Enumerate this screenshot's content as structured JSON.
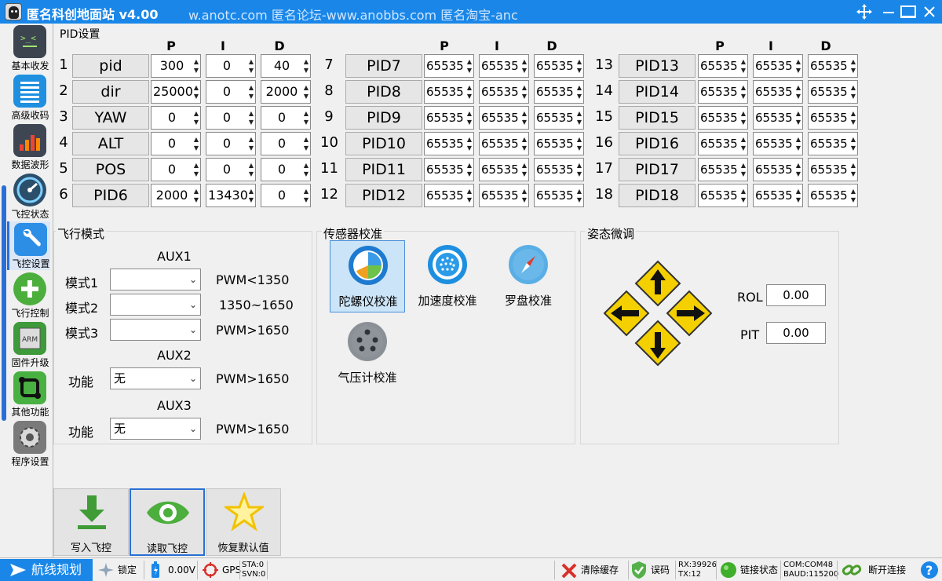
{
  "titlebar": {
    "title": "匿名科创地面站 v4.00",
    "marquee": "w.anotc.com  匿名论坛-www.anobbs.com  匿名淘宝-anc"
  },
  "nav": [
    {
      "label": "基本收发",
      "icon": "terminal-icon"
    },
    {
      "label": "高级收码",
      "icon": "list-icon"
    },
    {
      "label": "数据波形",
      "icon": "bar-chart-icon"
    },
    {
      "label": "飞控状态",
      "icon": "gauge-icon"
    },
    {
      "label": "飞控设置",
      "icon": "wrench-icon"
    },
    {
      "label": "飞行控制",
      "icon": "plus-icon"
    },
    {
      "label": "固件升级",
      "icon": "arm-chip-icon"
    },
    {
      "label": "其他功能",
      "icon": "square-link-icon"
    },
    {
      "label": "程序设置",
      "icon": "gear-icon"
    }
  ],
  "pid": {
    "title": "PID设置",
    "headers": [
      "P",
      "I",
      "D"
    ],
    "rows": [
      {
        "num": "1",
        "name": "pid",
        "p": "300",
        "i": "0",
        "d": "40"
      },
      {
        "num": "2",
        "name": "dir",
        "p": "25000",
        "i": "0",
        "d": "2000"
      },
      {
        "num": "3",
        "name": "YAW",
        "p": "0",
        "i": "0",
        "d": "0"
      },
      {
        "num": "4",
        "name": "ALT",
        "p": "0",
        "i": "0",
        "d": "0"
      },
      {
        "num": "5",
        "name": "POS",
        "p": "0",
        "i": "0",
        "d": "0"
      },
      {
        "num": "6",
        "name": "PID6",
        "p": "2000",
        "i": "13430",
        "d": "0"
      },
      {
        "num": "7",
        "name": "PID7",
        "p": "65535",
        "i": "65535",
        "d": "65535"
      },
      {
        "num": "8",
        "name": "PID8",
        "p": "65535",
        "i": "65535",
        "d": "65535"
      },
      {
        "num": "9",
        "name": "PID9",
        "p": "65535",
        "i": "65535",
        "d": "65535"
      },
      {
        "num": "10",
        "name": "PID10",
        "p": "65535",
        "i": "65535",
        "d": "65535"
      },
      {
        "num": "11",
        "name": "PID11",
        "p": "65535",
        "i": "65535",
        "d": "65535"
      },
      {
        "num": "12",
        "name": "PID12",
        "p": "65535",
        "i": "65535",
        "d": "65535"
      },
      {
        "num": "13",
        "name": "PID13",
        "p": "65535",
        "i": "65535",
        "d": "65535"
      },
      {
        "num": "14",
        "name": "PID14",
        "p": "65535",
        "i": "65535",
        "d": "65535"
      },
      {
        "num": "15",
        "name": "PID15",
        "p": "65535",
        "i": "65535",
        "d": "65535"
      },
      {
        "num": "16",
        "name": "PID16",
        "p": "65535",
        "i": "65535",
        "d": "65535"
      },
      {
        "num": "17",
        "name": "PID17",
        "p": "65535",
        "i": "65535",
        "d": "65535"
      },
      {
        "num": "18",
        "name": "PID18",
        "p": "65535",
        "i": "65535",
        "d": "65535"
      }
    ]
  },
  "flight_mode": {
    "title": "飞行模式",
    "aux1": "AUX1",
    "modes": [
      {
        "label": "模式1",
        "value": "",
        "range": "PWM<1350"
      },
      {
        "label": "模式2",
        "value": "",
        "range": "1350~1650"
      },
      {
        "label": "模式3",
        "value": "",
        "range": "PWM>1650"
      }
    ],
    "aux2": "AUX2",
    "aux2_func": {
      "label": "功能",
      "value": "无",
      "range": "PWM>1650"
    },
    "aux3": "AUX3",
    "aux3_func": {
      "label": "功能",
      "value": "无",
      "range": "PWM>1650"
    }
  },
  "sensor": {
    "title": "传感器校准",
    "items": [
      "陀螺仪校准",
      "加速度校准",
      "罗盘校准",
      "气压计校准"
    ]
  },
  "attitude": {
    "title": "姿态微调",
    "rol_label": "ROL",
    "rol_value": "0.00",
    "pit_label": "PIT",
    "pit_value": "0.00"
  },
  "actions": {
    "write": "写入飞控",
    "read": "读取飞控",
    "reset": "恢复默认值"
  },
  "status": {
    "route": "航线规划",
    "lock": "锁定",
    "voltage": "0.00V",
    "gps": "GPS",
    "sta": "STA:0",
    "svn": "SVN:0",
    "clear": "清除缓存",
    "error": "误码",
    "rx": "RX:39926",
    "tx": "TX:12",
    "link": "链接状态",
    "com": "COM:COM48",
    "baud": "BAUD:115200",
    "disconnect": "断开连接"
  },
  "colors": {
    "accent": "#1a87e8",
    "arrow_yellow": "#f5d000"
  }
}
